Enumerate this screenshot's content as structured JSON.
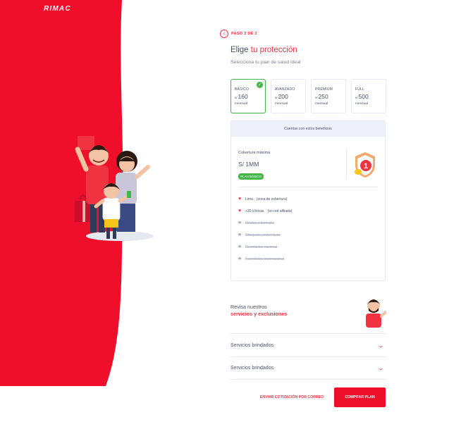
{
  "brand": {
    "logo_text": "RIMAC",
    "primary_color": "#ef0f2a",
    "success_color": "#43b748"
  },
  "step": {
    "back_icon": "chevron-left-icon",
    "label": "PASO 2 DE 2"
  },
  "header": {
    "title_prefix": "Elige",
    "title_accent": "tu protección",
    "subtitle": "Selecciona tu plan de salud ideal"
  },
  "plans": [
    {
      "name": "BÁSICO",
      "currency": "s/",
      "price": "160",
      "period": "mensual",
      "selected": true
    },
    {
      "name": "AVANZADO",
      "currency": "s/",
      "price": "200",
      "period": "mensual",
      "selected": false
    },
    {
      "name": "PREMIUM",
      "currency": "s/",
      "price": "250",
      "period": "mensual",
      "selected": false
    },
    {
      "name": "FULL",
      "currency": "s/",
      "price": "500",
      "period": "mensual",
      "selected": false
    }
  ],
  "benefits": {
    "header": "Cuentas con estos beneficios",
    "coverage_label": "Cobertura máxima",
    "coverage_value": "S/ 1MM",
    "badge": "PLAN BÁSICO",
    "shield_number": "1",
    "items": [
      {
        "text": "Lima",
        "note": "(zona de cobertura)",
        "active": true
      },
      {
        "text": "+30 clínicas",
        "note": "(en red afiliada)",
        "active": true
      },
      {
        "text": "Médico a domicilio",
        "note": "",
        "active": false
      },
      {
        "text": "Chequeos preventivos",
        "note": "",
        "active": false
      },
      {
        "text": "Reembolso nacional",
        "note": "",
        "active": false
      },
      {
        "text": "Reembolso internacional",
        "note": "",
        "active": false
      }
    ]
  },
  "review": {
    "line1": "Revisa nuestros",
    "line2": "servicios y exclusiones"
  },
  "accordions": [
    {
      "label": "Servicios brindados",
      "icon": "chevron-down-icon"
    },
    {
      "label": "Servicios brindados",
      "icon": "chevron-down-icon"
    }
  ],
  "actions": {
    "email_label": "ENVIAR COTIZACIÓN POR CORREO",
    "buy_label": "COMPRAR PLAN"
  }
}
